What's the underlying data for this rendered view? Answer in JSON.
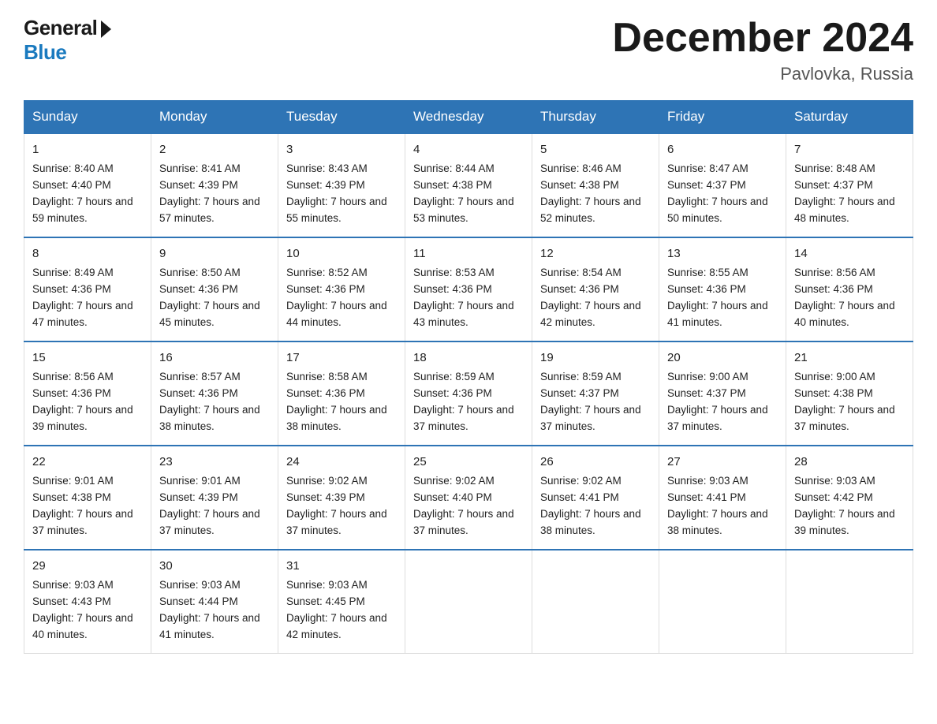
{
  "logo": {
    "general": "General",
    "blue": "Blue"
  },
  "title": "December 2024",
  "location": "Pavlovka, Russia",
  "days_of_week": [
    "Sunday",
    "Monday",
    "Tuesday",
    "Wednesday",
    "Thursday",
    "Friday",
    "Saturday"
  ],
  "weeks": [
    [
      {
        "day": "1",
        "sunrise": "8:40 AM",
        "sunset": "4:40 PM",
        "daylight": "7 hours and 59 minutes."
      },
      {
        "day": "2",
        "sunrise": "8:41 AM",
        "sunset": "4:39 PM",
        "daylight": "7 hours and 57 minutes."
      },
      {
        "day": "3",
        "sunrise": "8:43 AM",
        "sunset": "4:39 PM",
        "daylight": "7 hours and 55 minutes."
      },
      {
        "day": "4",
        "sunrise": "8:44 AM",
        "sunset": "4:38 PM",
        "daylight": "7 hours and 53 minutes."
      },
      {
        "day": "5",
        "sunrise": "8:46 AM",
        "sunset": "4:38 PM",
        "daylight": "7 hours and 52 minutes."
      },
      {
        "day": "6",
        "sunrise": "8:47 AM",
        "sunset": "4:37 PM",
        "daylight": "7 hours and 50 minutes."
      },
      {
        "day": "7",
        "sunrise": "8:48 AM",
        "sunset": "4:37 PM",
        "daylight": "7 hours and 48 minutes."
      }
    ],
    [
      {
        "day": "8",
        "sunrise": "8:49 AM",
        "sunset": "4:36 PM",
        "daylight": "7 hours and 47 minutes."
      },
      {
        "day": "9",
        "sunrise": "8:50 AM",
        "sunset": "4:36 PM",
        "daylight": "7 hours and 45 minutes."
      },
      {
        "day": "10",
        "sunrise": "8:52 AM",
        "sunset": "4:36 PM",
        "daylight": "7 hours and 44 minutes."
      },
      {
        "day": "11",
        "sunrise": "8:53 AM",
        "sunset": "4:36 PM",
        "daylight": "7 hours and 43 minutes."
      },
      {
        "day": "12",
        "sunrise": "8:54 AM",
        "sunset": "4:36 PM",
        "daylight": "7 hours and 42 minutes."
      },
      {
        "day": "13",
        "sunrise": "8:55 AM",
        "sunset": "4:36 PM",
        "daylight": "7 hours and 41 minutes."
      },
      {
        "day": "14",
        "sunrise": "8:56 AM",
        "sunset": "4:36 PM",
        "daylight": "7 hours and 40 minutes."
      }
    ],
    [
      {
        "day": "15",
        "sunrise": "8:56 AM",
        "sunset": "4:36 PM",
        "daylight": "7 hours and 39 minutes."
      },
      {
        "day": "16",
        "sunrise": "8:57 AM",
        "sunset": "4:36 PM",
        "daylight": "7 hours and 38 minutes."
      },
      {
        "day": "17",
        "sunrise": "8:58 AM",
        "sunset": "4:36 PM",
        "daylight": "7 hours and 38 minutes."
      },
      {
        "day": "18",
        "sunrise": "8:59 AM",
        "sunset": "4:36 PM",
        "daylight": "7 hours and 37 minutes."
      },
      {
        "day": "19",
        "sunrise": "8:59 AM",
        "sunset": "4:37 PM",
        "daylight": "7 hours and 37 minutes."
      },
      {
        "day": "20",
        "sunrise": "9:00 AM",
        "sunset": "4:37 PM",
        "daylight": "7 hours and 37 minutes."
      },
      {
        "day": "21",
        "sunrise": "9:00 AM",
        "sunset": "4:38 PM",
        "daylight": "7 hours and 37 minutes."
      }
    ],
    [
      {
        "day": "22",
        "sunrise": "9:01 AM",
        "sunset": "4:38 PM",
        "daylight": "7 hours and 37 minutes."
      },
      {
        "day": "23",
        "sunrise": "9:01 AM",
        "sunset": "4:39 PM",
        "daylight": "7 hours and 37 minutes."
      },
      {
        "day": "24",
        "sunrise": "9:02 AM",
        "sunset": "4:39 PM",
        "daylight": "7 hours and 37 minutes."
      },
      {
        "day": "25",
        "sunrise": "9:02 AM",
        "sunset": "4:40 PM",
        "daylight": "7 hours and 37 minutes."
      },
      {
        "day": "26",
        "sunrise": "9:02 AM",
        "sunset": "4:41 PM",
        "daylight": "7 hours and 38 minutes."
      },
      {
        "day": "27",
        "sunrise": "9:03 AM",
        "sunset": "4:41 PM",
        "daylight": "7 hours and 38 minutes."
      },
      {
        "day": "28",
        "sunrise": "9:03 AM",
        "sunset": "4:42 PM",
        "daylight": "7 hours and 39 minutes."
      }
    ],
    [
      {
        "day": "29",
        "sunrise": "9:03 AM",
        "sunset": "4:43 PM",
        "daylight": "7 hours and 40 minutes."
      },
      {
        "day": "30",
        "sunrise": "9:03 AM",
        "sunset": "4:44 PM",
        "daylight": "7 hours and 41 minutes."
      },
      {
        "day": "31",
        "sunrise": "9:03 AM",
        "sunset": "4:45 PM",
        "daylight": "7 hours and 42 minutes."
      },
      null,
      null,
      null,
      null
    ]
  ],
  "labels": {
    "sunrise": "Sunrise:",
    "sunset": "Sunset:",
    "daylight": "Daylight:"
  }
}
